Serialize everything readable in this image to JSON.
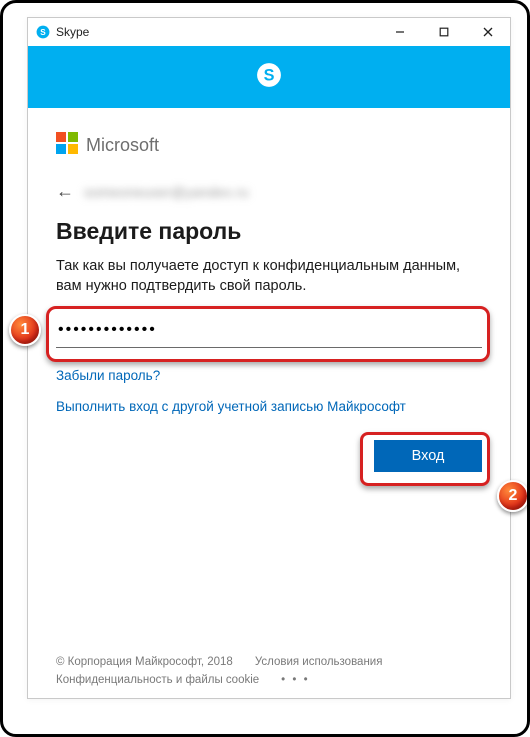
{
  "window": {
    "title": "Skype"
  },
  "brand": {
    "microsoft_label": "Microsoft"
  },
  "identity": {
    "email_blurred": "someoneuser@yandex.ru"
  },
  "auth": {
    "heading": "Введите пароль",
    "description": "Так как вы получаете доступ к конфиденциальным данным, вам нужно подтвердить свой пароль.",
    "password_value": "•••••••••••••",
    "forgot_link": "Забыли пароль?",
    "other_account_link": "Выполнить вход с другой учетной записью Майкрософт",
    "signin_label": "Вход"
  },
  "footer": {
    "copyright": "© Корпорация Майкрософт, 2018",
    "terms": "Условия использования",
    "privacy": "Конфиденциальность и файлы cookie",
    "more": "• • •"
  },
  "callouts": {
    "one": "1",
    "two": "2"
  }
}
